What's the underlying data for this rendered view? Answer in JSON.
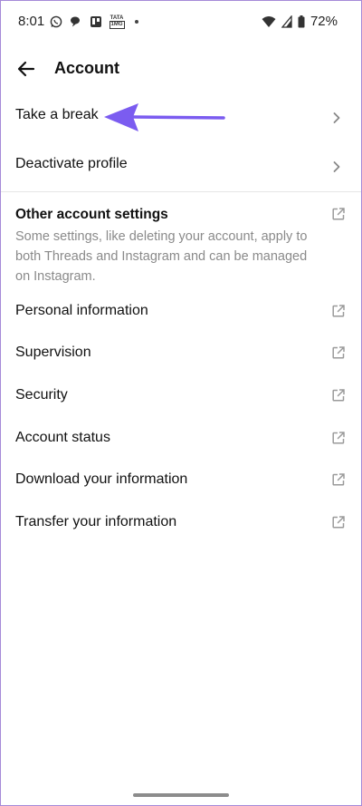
{
  "status_bar": {
    "time": "8:01",
    "battery": "72%",
    "carrier_badge_top": "TATA",
    "carrier_badge_bottom": "1MG"
  },
  "header": {
    "title": "Account"
  },
  "menu": {
    "take_break": "Take a break",
    "deactivate": "Deactivate profile"
  },
  "other_settings": {
    "title": "Other account settings",
    "description": "Some settings, like deleting your account, apply to both Threads and Instagram and can be managed on Instagram.",
    "items": [
      "Personal information",
      "Supervision",
      "Security",
      "Account status",
      "Download your information",
      "Transfer your information"
    ]
  },
  "colors": {
    "annotation_arrow": "#7b5cf0",
    "muted_text": "#8a8a8a",
    "icon_gray": "#9a9a9a"
  }
}
